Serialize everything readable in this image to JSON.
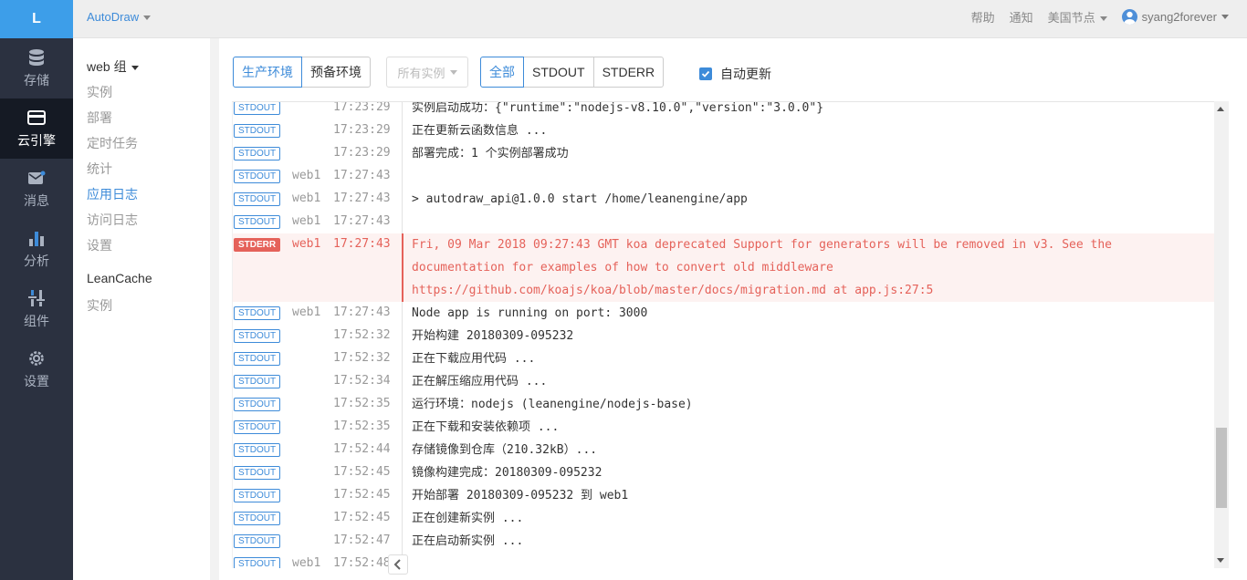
{
  "logo": "L",
  "nav": [
    {
      "label": "存储",
      "icon": "database-icon"
    },
    {
      "label": "云引擎",
      "icon": "engine-icon"
    },
    {
      "label": "消息",
      "icon": "message-icon"
    },
    {
      "label": "分析",
      "icon": "bar-chart-icon"
    },
    {
      "label": "组件",
      "icon": "sliders-icon"
    },
    {
      "label": "设置",
      "icon": "gear-icon"
    }
  ],
  "topbar": {
    "app_name": "AutoDraw",
    "help": "帮助",
    "notify": "通知",
    "region": "美国节点",
    "user": "syang2forever"
  },
  "submenu": {
    "group1": "web 组",
    "items1": [
      "实例",
      "部署",
      "定时任务",
      "统计",
      "应用日志",
      "访问日志",
      "设置"
    ],
    "active": "应用日志",
    "group2": "LeanCache",
    "items2": [
      "实例"
    ]
  },
  "toolbar": {
    "env_prod": "生产环境",
    "env_stage": "预备环境",
    "instances": "所有实例",
    "filter_all": "全部",
    "filter_stdout": "STDOUT",
    "filter_stderr": "STDERR",
    "auto_update": "自动更新"
  },
  "logs": [
    {
      "stream": "STDOUT",
      "instance": "",
      "time": "17:23:29",
      "message": "实例启动成功：{\"runtime\":\"nodejs-v8.10.0\",\"version\":\"3.0.0\"}"
    },
    {
      "stream": "STDOUT",
      "instance": "",
      "time": "17:23:29",
      "message": "正在更新云函数信息 ..."
    },
    {
      "stream": "STDOUT",
      "instance": "",
      "time": "17:23:29",
      "message": "部署完成：1 个实例部署成功"
    },
    {
      "stream": "STDOUT",
      "instance": "web1",
      "time": "17:27:43",
      "message": ""
    },
    {
      "stream": "STDOUT",
      "instance": "web1",
      "time": "17:27:43",
      "message": "> autodraw_api@1.0.0 start /home/leanengine/app"
    },
    {
      "stream": "STDOUT",
      "instance": "web1",
      "time": "17:27:43",
      "message": ""
    },
    {
      "stream": "STDERR",
      "instance": "web1",
      "time": "17:27:43",
      "message": "Fri, 09 Mar 2018 09:27:43 GMT koa deprecated Support for generators will be removed in v3. See the documentation for examples of how to convert old middleware https://github.com/koajs/koa/blob/master/docs/migration.md at app.js:27:5"
    },
    {
      "stream": "STDOUT",
      "instance": "web1",
      "time": "17:27:43",
      "message": "Node app is running on port: 3000"
    },
    {
      "stream": "STDOUT",
      "instance": "",
      "time": "17:52:32",
      "message": "开始构建 20180309-095232"
    },
    {
      "stream": "STDOUT",
      "instance": "",
      "time": "17:52:32",
      "message": "正在下载应用代码 ..."
    },
    {
      "stream": "STDOUT",
      "instance": "",
      "time": "17:52:34",
      "message": "正在解压缩应用代码 ..."
    },
    {
      "stream": "STDOUT",
      "instance": "",
      "time": "17:52:35",
      "message": "运行环境：nodejs (leanengine/nodejs-base)"
    },
    {
      "stream": "STDOUT",
      "instance": "",
      "time": "17:52:35",
      "message": "正在下载和安装依赖项 ..."
    },
    {
      "stream": "STDOUT",
      "instance": "",
      "time": "17:52:44",
      "message": "存储镜像到仓库（210.32kB）..."
    },
    {
      "stream": "STDOUT",
      "instance": "",
      "time": "17:52:45",
      "message": "镜像构建完成：20180309-095232"
    },
    {
      "stream": "STDOUT",
      "instance": "",
      "time": "17:52:45",
      "message": "开始部署 20180309-095232 到 web1"
    },
    {
      "stream": "STDOUT",
      "instance": "",
      "time": "17:52:45",
      "message": "正在创建新实例 ..."
    },
    {
      "stream": "STDOUT",
      "instance": "",
      "time": "17:52:47",
      "message": "正在启动新实例 ..."
    },
    {
      "stream": "STDOUT",
      "instance": "web1",
      "time": "17:52:48",
      "message": ""
    }
  ],
  "colors": {
    "accent": "#3d8bd9",
    "error": "#e5625a",
    "sidebar": "#2b3140"
  }
}
